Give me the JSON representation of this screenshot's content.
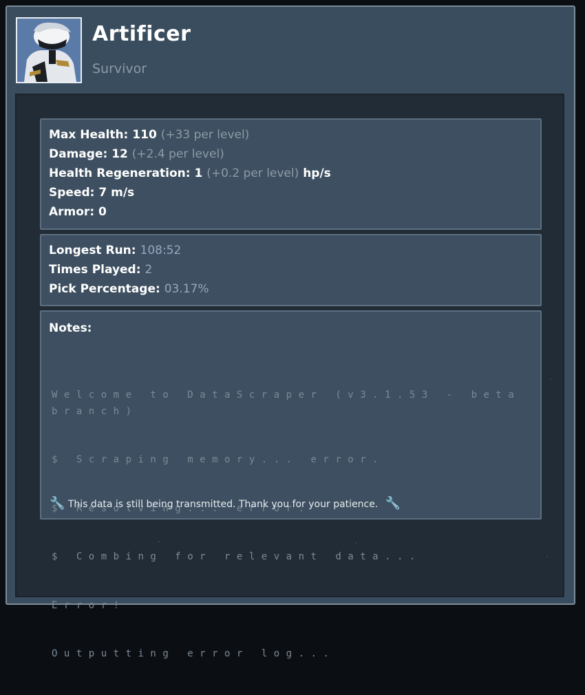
{
  "header": {
    "name": "Artificer",
    "subtitle": "Survivor"
  },
  "base_stats": [
    {
      "label": "Max Health:",
      "value": "110",
      "scaling": "(+33 per level)",
      "unit": ""
    },
    {
      "label": "Damage:",
      "value": "12",
      "scaling": "(+2.4 per level)",
      "unit": ""
    },
    {
      "label": "Health Regeneration:",
      "value": "1",
      "scaling": "(+0.2 per level)",
      "unit": "hp/s"
    },
    {
      "label": "Speed:",
      "value": "7 m/s",
      "scaling": "",
      "unit": ""
    },
    {
      "label": "Armor:",
      "value": "0",
      "scaling": "",
      "unit": ""
    }
  ],
  "run_stats": [
    {
      "label": "Longest Run:",
      "value": "108:52"
    },
    {
      "label": "Times Played:",
      "value": "2"
    },
    {
      "label": "Pick Percentage:",
      "value": "03.17%"
    }
  ],
  "notes": {
    "heading": "Notes:",
    "lines": [
      "Welcome to DataScraper (v3.1.53 - beta branch)",
      "$ Scraping memory... error.",
      "$ Resolving... error.",
      "$ Combing for relevant data...",
      "Error!",
      "Outputting error log..."
    ],
    "footer": "This data is still being transmitted. Thank you for your patience.",
    "footer_icon": "wrench-icon"
  },
  "colors": {
    "window_bg": "#3a4d5e",
    "inner_bg": "#222c37",
    "panel_bg": "#3d4f60",
    "muted_text": "#8f9ba6",
    "value_text": "#9aa7c0",
    "wrench": "#e8b43a"
  }
}
